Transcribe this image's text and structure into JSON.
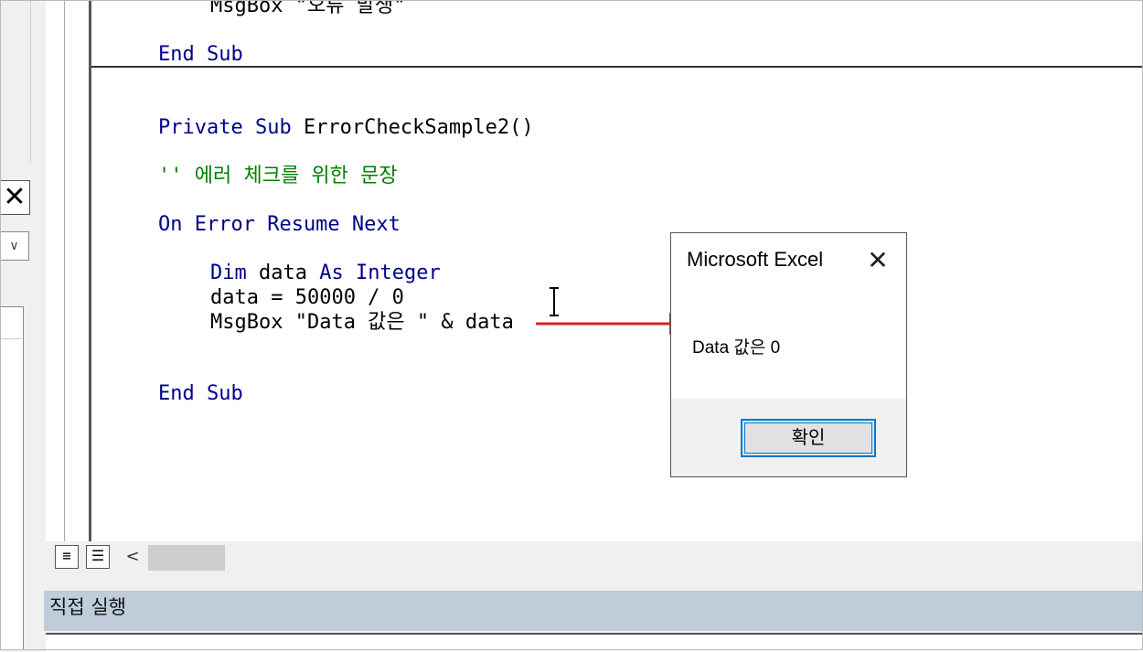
{
  "code_lines": {
    "msgbox_top": "MsgBox \"오류 발생\"",
    "end_sub_1": "End Sub",
    "private_kw": "Private Sub",
    "proc_name": " ErrorCheckSample2()",
    "comment": "'' 에러 체크를 위한 문장",
    "on_error": "On Error Resume Next",
    "dim_kw1": "Dim",
    "dim_mid": " data ",
    "dim_kw2": "As Integer",
    "data_assign": "data = 50000 / 0",
    "msgbox": "MsgBox \"Data 값은 \" & data",
    "end_sub_2": "End Sub"
  },
  "left_panel": {
    "close_glyph": "✕",
    "dropdown_glyph": "∨"
  },
  "scroll": {
    "view_proc_glyph": "≡",
    "view_full_glyph": "☰",
    "left_arrow": "<"
  },
  "immediate_window": {
    "title": "직접 실행"
  },
  "dialog": {
    "title": "Microsoft Excel",
    "close_glyph": "✕",
    "message": "Data 값은 0",
    "ok_label": "확인"
  },
  "colors": {
    "keyword": "#00008b",
    "comment": "#008000",
    "arrow": "#e02020",
    "button_focus": "#0078d7"
  }
}
